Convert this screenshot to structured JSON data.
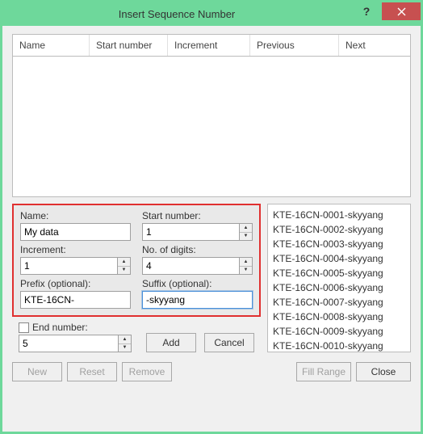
{
  "window": {
    "title": "Insert Sequence Number"
  },
  "columns": {
    "name": "Name",
    "start": "Start number",
    "incr": "Increment",
    "prev": "Previous",
    "next": "Next"
  },
  "form": {
    "name_label": "Name:",
    "name_value": "My data",
    "start_label": "Start number:",
    "start_value": "1",
    "incr_label": "Increment:",
    "incr_value": "1",
    "digits_label": "No. of digits:",
    "digits_value": "4",
    "prefix_label": "Prefix (optional):",
    "prefix_value": "KTE-16CN-",
    "suffix_label": "Suffix (optional):",
    "suffix_value": "-skyyang",
    "end_label": "End number:",
    "end_value": "5"
  },
  "buttons": {
    "add": "Add",
    "cancel": "Cancel",
    "new": "New",
    "reset": "Reset",
    "remove": "Remove",
    "fill": "Fill Range",
    "close": "Close"
  },
  "preview": [
    "KTE-16CN-0001-skyyang",
    "KTE-16CN-0002-skyyang",
    "KTE-16CN-0003-skyyang",
    "KTE-16CN-0004-skyyang",
    "KTE-16CN-0005-skyyang",
    "KTE-16CN-0006-skyyang",
    "KTE-16CN-0007-skyyang",
    "KTE-16CN-0008-skyyang",
    "KTE-16CN-0009-skyyang",
    "KTE-16CN-0010-skyyang"
  ]
}
